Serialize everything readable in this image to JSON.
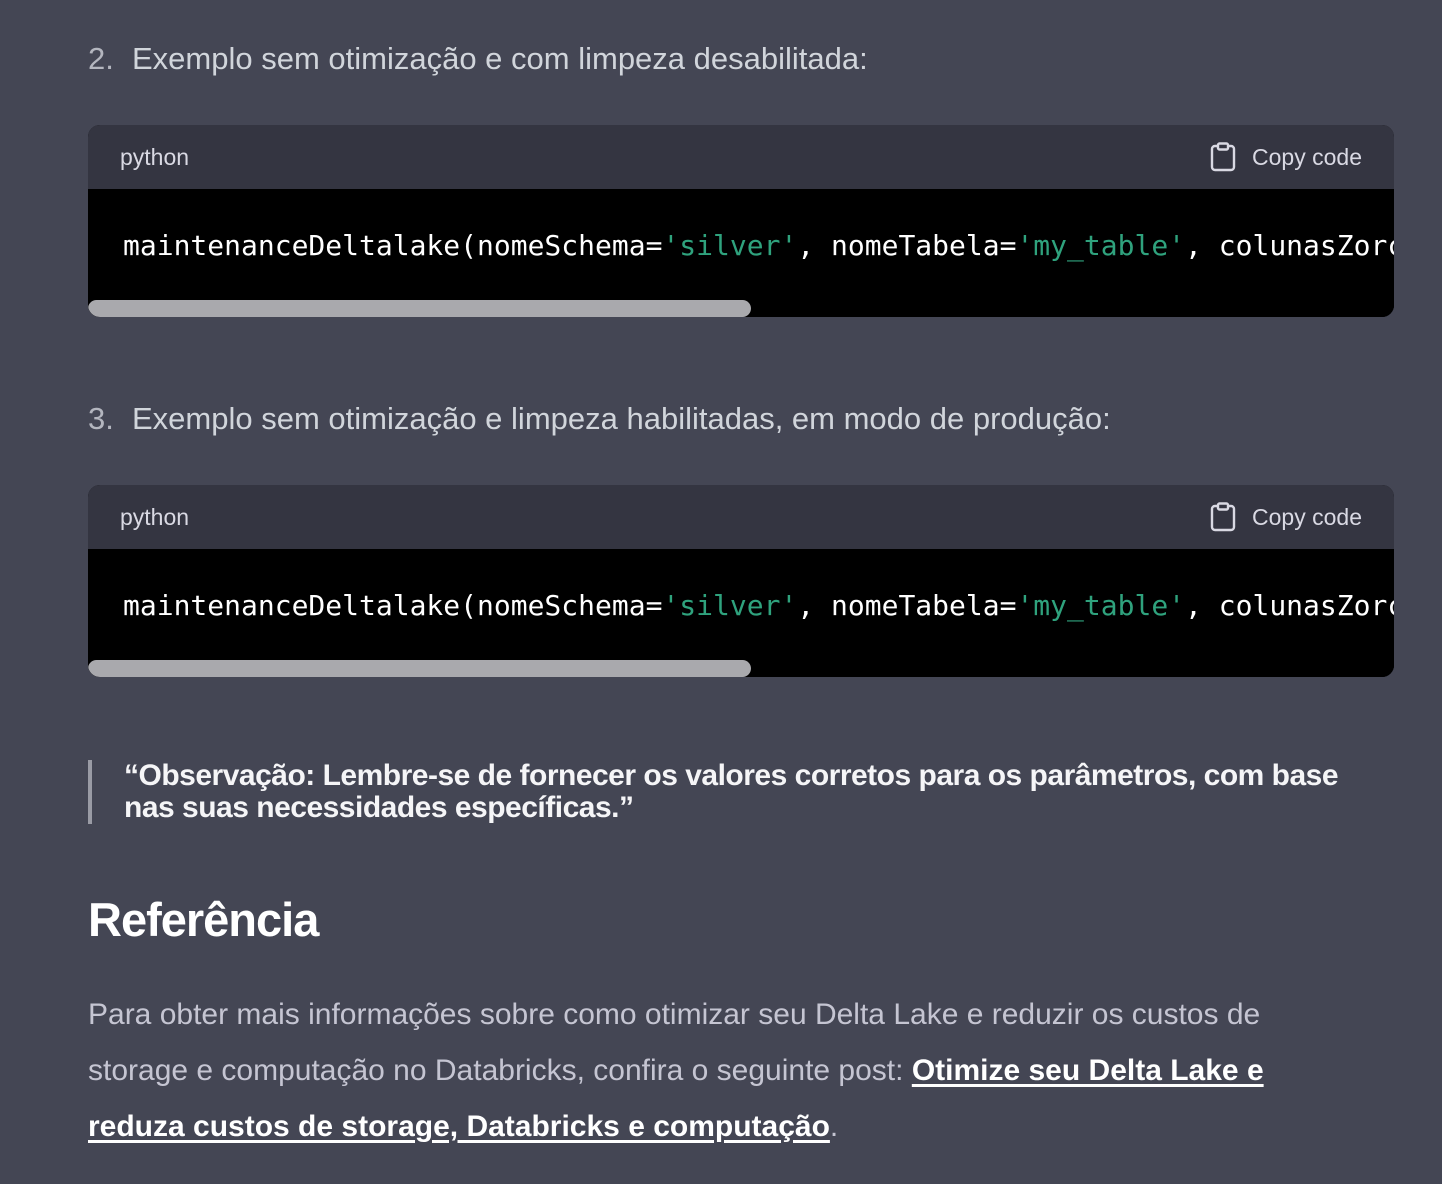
{
  "items": [
    {
      "number": "2.",
      "text": "Exemplo sem otimização e com limpeza desabilitada:",
      "code": {
        "language": "python",
        "copy_label": "Copy code",
        "tokens": [
          {
            "text": "maintenanceDeltalake(nomeSchema=",
            "kind": "plain"
          },
          {
            "text": "'silver'",
            "kind": "string"
          },
          {
            "text": ", nomeTabela=",
            "kind": "plain"
          },
          {
            "text": "'my_table'",
            "kind": "string"
          },
          {
            "text": ", colunasZorc",
            "kind": "plain"
          }
        ]
      }
    },
    {
      "number": "3.",
      "text": "Exemplo sem otimização e limpeza habilitadas, em modo de produção:",
      "code": {
        "language": "python",
        "copy_label": "Copy code",
        "tokens": [
          {
            "text": "maintenanceDeltalake(nomeSchema=",
            "kind": "plain"
          },
          {
            "text": "'silver'",
            "kind": "string"
          },
          {
            "text": ", nomeTabela=",
            "kind": "plain"
          },
          {
            "text": "'my_table'",
            "kind": "string"
          },
          {
            "text": ", colunasZorc",
            "kind": "plain"
          }
        ]
      }
    }
  ],
  "quote": {
    "line1": "“Observação: Lembre-se de fornecer os valores corretos para os parâmetros, com base",
    "line2": "nas suas necessidades específicas.”"
  },
  "reference": {
    "heading": "Referência",
    "text_before": "Para obter mais informações sobre como otimizar seu Delta Lake e reduzir os custos de storage e computação no Databricks, confira o seguinte post: ",
    "link_text": "Otimize seu Delta Lake e reduza custos de storage, Databricks e computação",
    "text_after": "."
  },
  "colors": {
    "background": "#444654",
    "code_header": "#343541",
    "code_body": "#000000",
    "string_token": "#2fa27d"
  },
  "icons": {
    "copy": "clipboard-icon"
  }
}
